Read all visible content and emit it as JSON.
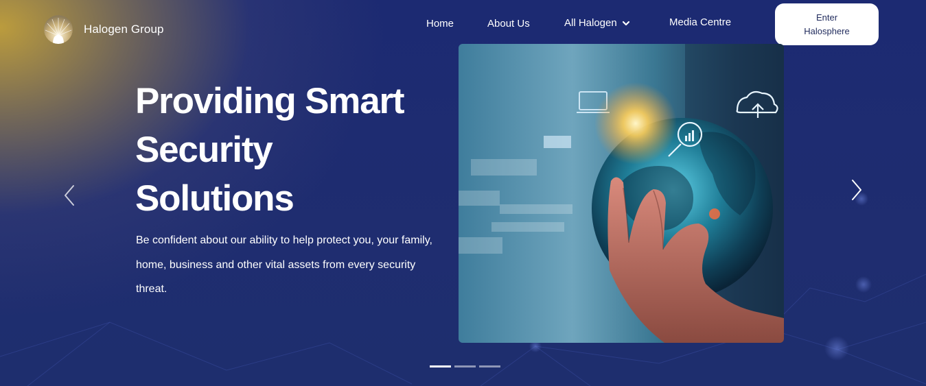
{
  "brand": {
    "name": "Halogen Group",
    "logo_icon": "halogen-sunburst-logo"
  },
  "nav": {
    "items": [
      {
        "label": "Home"
      },
      {
        "label": "About Us"
      },
      {
        "label": "All Halogen",
        "icon": "chevron-down-icon"
      },
      {
        "label": "Media Centre"
      }
    ],
    "cta_label": "Enter Halosphere"
  },
  "hero": {
    "headline": "Providing Smart Security Solutions",
    "subtext": "Be confident about our ability to help protect you, your family, home, business and other vital assets from every security threat.",
    "image_icon": "hand-holding-globe-image",
    "prev_icon": "chevron-left-icon",
    "next_icon": "chevron-right-icon",
    "slide_count": 3,
    "active_slide": 1
  },
  "colors": {
    "background": "#1f2d70",
    "gold_glow": "#c4a23a",
    "cta_background": "#ffffff",
    "cta_text": "#1f2a5c"
  }
}
